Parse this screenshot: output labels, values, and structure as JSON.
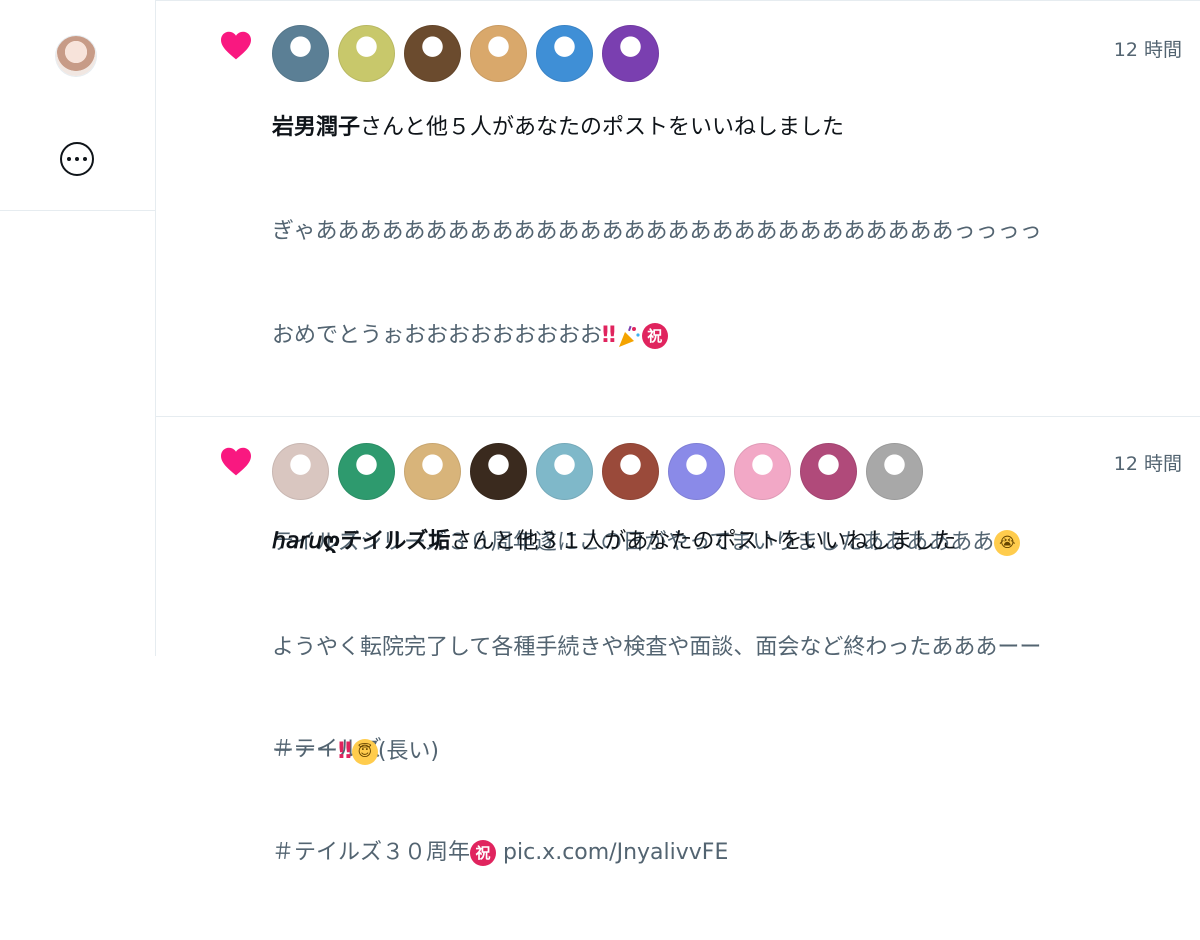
{
  "colors": {
    "heart": "#f91880",
    "body_text": "#536471",
    "headline_text": "#0f1419",
    "divider": "#e6ecf0"
  },
  "sidebar": {
    "avatar_icon": "profile-avatar",
    "more_icon": "ellipsis-circle-icon"
  },
  "notifications": [
    {
      "type": "like",
      "icon": "heart-icon",
      "time": "12 時間",
      "actor_name": "岩男潤子",
      "headline_rest": "さんと他５人があなたのポストをいいねしました",
      "avatar_count": 6,
      "avatar_colors": [
        "#5b7f95",
        "#c8c86b",
        "#6b4b2e",
        "#d9a86b",
        "#3f8fd6",
        "#7a3fb0"
      ],
      "body_lines": [
        "ぎゃあああああああああああああああああああああああああああああっっっっ",
        "おめでとうぉおおおおおおおおお",
        "",
        "テイルズシリーズ３０周年遂にこの日がやってまいりましたああああああ",
        "",
        "＃テイルズ",
        "＃テイルズ３０周年",
        "pic.x.com/JnyalivvFE"
      ],
      "emoji": {
        "double_exclamation": "‼",
        "party_popper": "party-popper-icon",
        "celebrate_badge": "祝",
        "crying_face": "😭"
      }
    },
    {
      "type": "like",
      "icon": "heart-icon",
      "time": "12 時間",
      "actor_name": "𝘩𝘢𝘳𝘶ღテイルズ垢",
      "headline_rest": "さんと他３１人があなたのポストをいいねしました",
      "avatar_count": 10,
      "avatar_colors": [
        "#d9c6c0",
        "#2e9a6e",
        "#d8b47a",
        "#3a2a1e",
        "#7fb8c9",
        "#9a4a3a",
        "#8a8ae8",
        "#f2a8c6",
        "#b04a7a",
        "#a8a8a8"
      ],
      "body_lines": [
        "ようやく転院完了して各種手続きや検査や面談、面会など終わったあああーー",
        "ーーー",
        "(長い)"
      ],
      "emoji": {
        "double_exclamation": "‼",
        "angel_face": "😇"
      }
    }
  ]
}
